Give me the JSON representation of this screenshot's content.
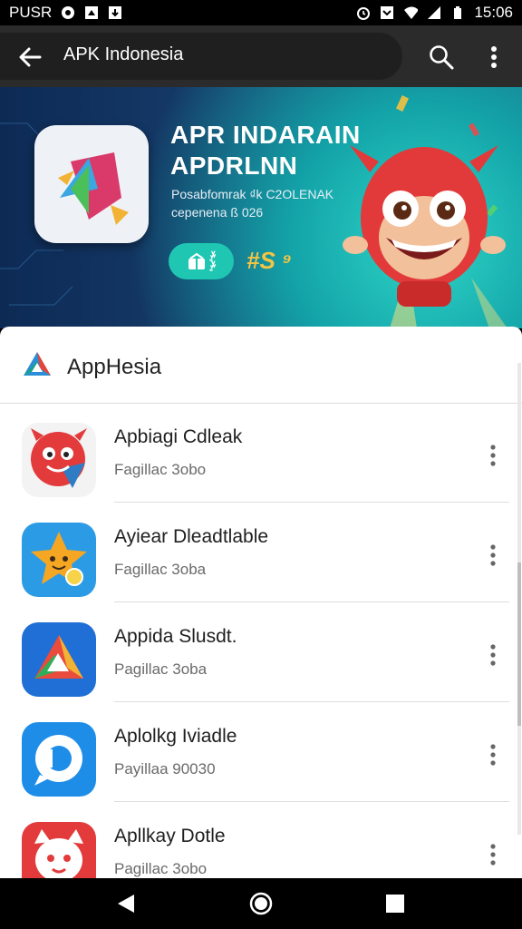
{
  "status_bar": {
    "carrier": "PUSR",
    "time": "15:06",
    "icons": [
      "notification-icon",
      "upload-icon",
      "download-icon",
      "alarm-icon",
      "dnd-icon",
      "wifi-icon",
      "signal-icon",
      "battery-icon"
    ]
  },
  "toolbar": {
    "title": "APK Indonesia",
    "back_icon": "arrow-left-icon",
    "search_icon": "search-icon",
    "more_icon": "more-vert-icon"
  },
  "banner": {
    "headline_1": "APR INDARAIN",
    "headline_2": "APDRLNN",
    "sub_1": "Posabfomrak ₫k C2OLENAK",
    "sub_2": "cepenena ß 026",
    "chip_1": "ꕷ",
    "chip_text_1": "ꤸꥍ",
    "chip_text_2": "ꤸꥍ",
    "tag": "#S ⁹"
  },
  "sheet": {
    "title": "AppHesia"
  },
  "apps": [
    {
      "name": "Apbiagi Cdleak",
      "meta": "Fagillac 3obo",
      "icon": "red-monster-icon"
    },
    {
      "name": "Ayiear Dleadtlable",
      "meta": "Fagillac 3oba",
      "icon": "star-creature-icon"
    },
    {
      "name": "Appida Slusdt.",
      "meta": "Pagillac 3oba",
      "icon": "triangle-logo-icon"
    },
    {
      "name": "Aplolkg Iviadle",
      "meta": "Payillaa 90030",
      "icon": "chat-bubble-icon"
    },
    {
      "name": "Apllkay Dotle",
      "meta": "Pagillac 3obo",
      "icon": "red-cat-icon"
    }
  ],
  "colors": {
    "toolbar": "#2b2b2b",
    "accent_teal": "#1fc7b3",
    "mascot_red": "#e23a3a"
  }
}
